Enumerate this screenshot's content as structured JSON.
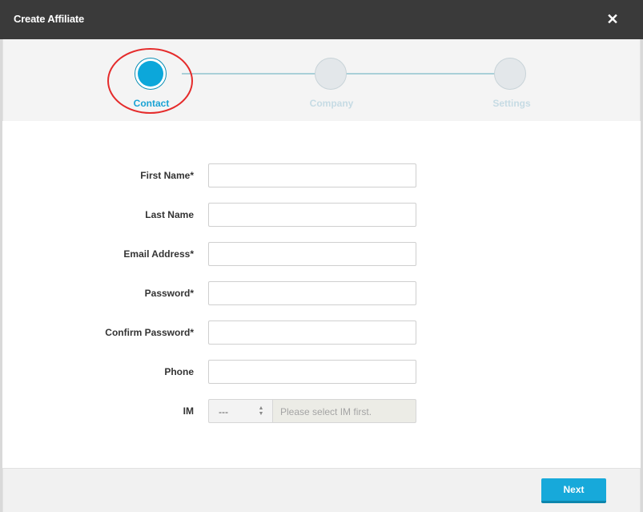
{
  "header": {
    "title": "Create Affiliate",
    "close_icon": "close-icon",
    "close_glyph": "✕"
  },
  "stepper": {
    "steps": [
      {
        "label": "Contact",
        "state": "active"
      },
      {
        "label": "Company",
        "state": "inactive"
      },
      {
        "label": "Settings",
        "state": "inactive"
      }
    ]
  },
  "form": {
    "first_name": {
      "label": "First Name*",
      "value": ""
    },
    "last_name": {
      "label": "Last Name",
      "value": ""
    },
    "email": {
      "label": "Email Address*",
      "value": ""
    },
    "password": {
      "label": "Password*",
      "value": ""
    },
    "confirm_password": {
      "label": "Confirm Password*",
      "value": ""
    },
    "phone": {
      "label": "Phone",
      "value": ""
    },
    "im": {
      "label": "IM",
      "selected": "---",
      "placeholder": "Please select IM first."
    }
  },
  "footer": {
    "next_label": "Next"
  },
  "colors": {
    "accent": "#17a9da",
    "header_bg": "#3a3a3a",
    "highlight": "#e52b2b"
  }
}
